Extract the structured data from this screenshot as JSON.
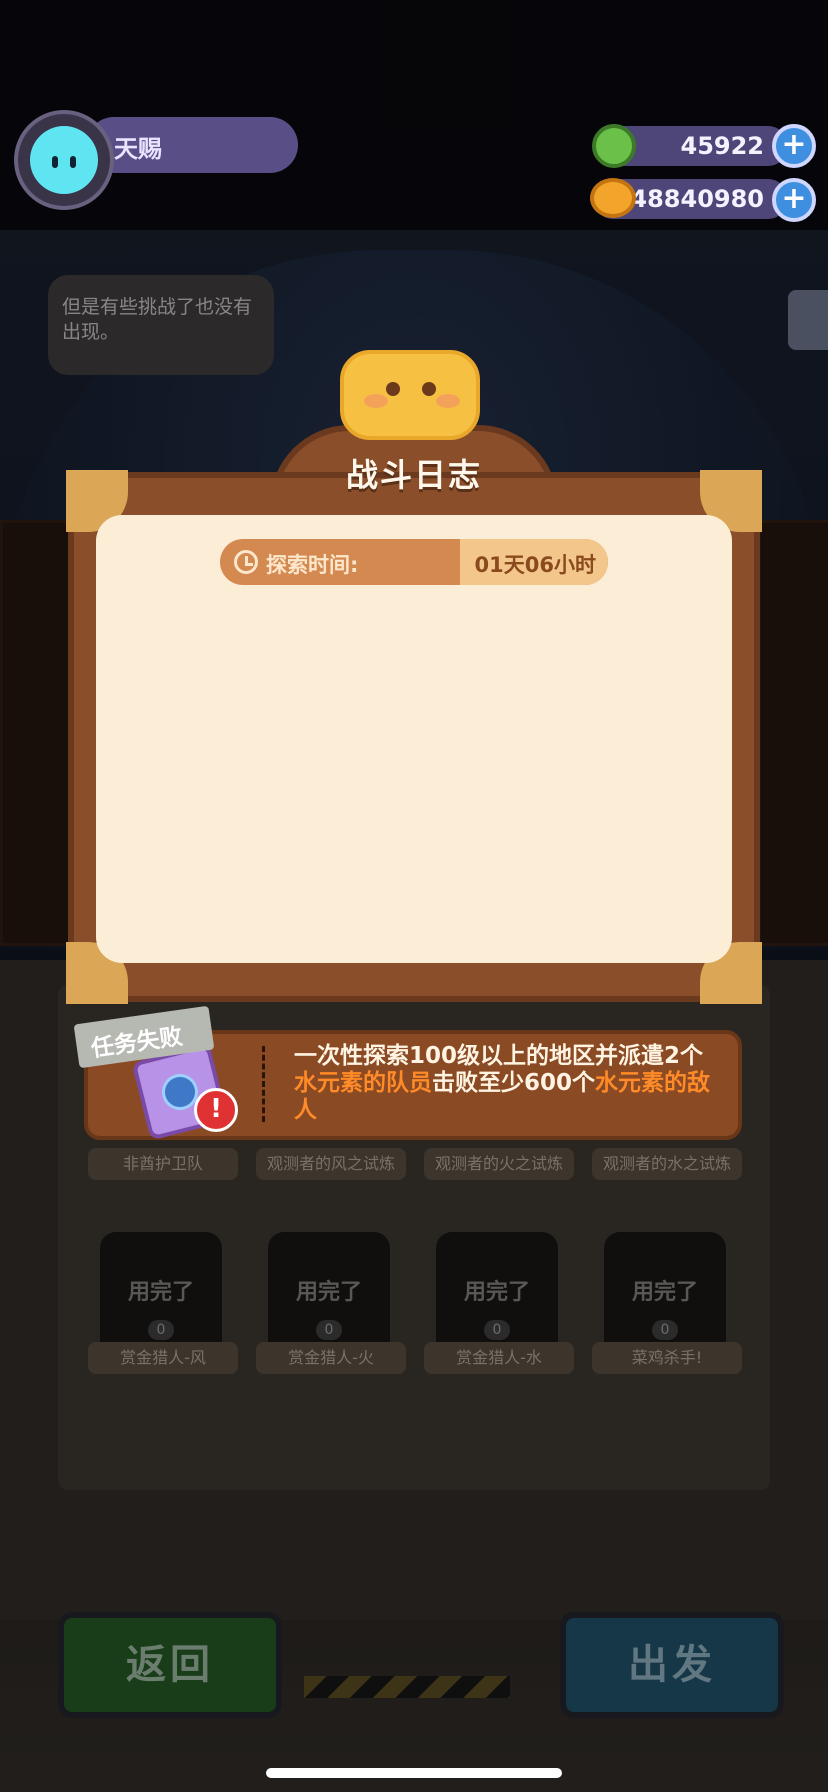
{
  "player": {
    "name": "天赐"
  },
  "resources": {
    "gems": "45922",
    "coins": "148840980"
  },
  "npc_dialog": "但是有些挑战了也没有出现。",
  "panel": {
    "title": "战斗日志",
    "explore_time_label": "探索时间:",
    "explore_time_value": "01天06小时"
  },
  "task": {
    "status": "任务失败",
    "desc_part1": "一次性探索100级以上的地区并派遣2个",
    "desc_hl1": "水元素的队员",
    "desc_part2": "击败至少600个",
    "desc_hl2": "水元素的敌人"
  },
  "row1_labels": [
    "非酋护卫队",
    "观测者的风之试炼",
    "观测者的火之试炼",
    "观测者的水之试炼"
  ],
  "row2": [
    {
      "overlay": "用完了",
      "count": "0",
      "label": "赏金猎人-风"
    },
    {
      "overlay": "用完了",
      "count": "0",
      "label": "赏金猎人-火"
    },
    {
      "overlay": "用完了",
      "count": "0",
      "label": "赏金猎人-水"
    },
    {
      "overlay": "用完了",
      "count": "0",
      "label": "菜鸡杀手!"
    }
  ],
  "buttons": {
    "back": "返回",
    "go": "出发"
  }
}
